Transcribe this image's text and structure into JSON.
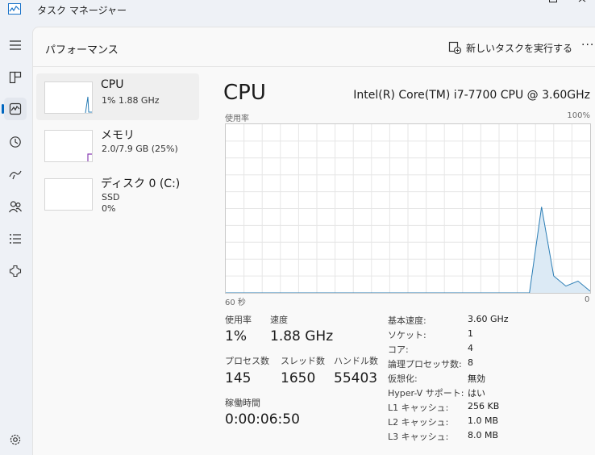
{
  "app": {
    "title": "タスク マネージャー"
  },
  "header": {
    "page_title": "パフォーマンス",
    "new_task_label": "新しいタスクを実行する",
    "more_label": "···"
  },
  "cards": [
    {
      "title": "CPU",
      "line1": "1%  1.88 GHz",
      "accent": "#2a7db5"
    },
    {
      "title": "メモリ",
      "line1": "2.0/7.9 GB (25%)",
      "accent": "#8a3fb3"
    },
    {
      "title": "ディスク 0 (C:)",
      "line1": "SSD",
      "line2": "0%",
      "accent": "#4d9b3b"
    }
  ],
  "detail": {
    "title": "CPU",
    "model": "Intel(R) Core(TM) i7-7700 CPU @ 3.60GHz",
    "graph_label": "使用率",
    "graph_max": "100%",
    "graph_left": "60 秒",
    "graph_right": "0",
    "stats": {
      "usage_label": "使用率",
      "usage_value": "1%",
      "speed_label": "速度",
      "speed_value": "1.88 GHz",
      "proc_label": "プロセス数",
      "proc_value": "145",
      "thread_label": "スレッド数",
      "thread_value": "1650",
      "handle_label": "ハンドル数",
      "handle_value": "55403",
      "uptime_label": "稼働時間",
      "uptime_value": "0:00:06:50"
    },
    "specs": [
      {
        "k": "基本速度:",
        "v": "3.60 GHz"
      },
      {
        "k": "ソケット:",
        "v": "1"
      },
      {
        "k": "コア:",
        "v": "4"
      },
      {
        "k": "論理プロセッサ数:",
        "v": "8"
      },
      {
        "k": "仮想化:",
        "v": "無効"
      },
      {
        "k": "Hyper-V サポート:",
        "v": "はい"
      },
      {
        "k": "L1 キャッシュ:",
        "v": "256 KB"
      },
      {
        "k": "L2 キャッシュ:",
        "v": "1.0 MB"
      },
      {
        "k": "L3 キャッシュ:",
        "v": "8.0 MB"
      }
    ]
  },
  "chart_data": {
    "type": "area",
    "x": [
      60,
      58,
      56,
      54,
      52,
      50,
      48,
      46,
      44,
      42,
      40,
      38,
      36,
      34,
      32,
      30,
      28,
      26,
      24,
      22,
      20,
      18,
      16,
      14,
      12,
      10,
      8,
      6,
      4,
      2,
      0
    ],
    "series": [
      {
        "values": [
          0,
          0,
          0,
          0,
          0,
          0,
          0,
          0,
          0,
          0,
          0,
          0,
          0,
          0,
          0,
          0,
          0,
          0,
          0,
          0,
          0,
          0,
          0,
          0,
          0,
          0,
          51,
          10,
          4,
          7,
          1
        ]
      }
    ],
    "ylim": [
      0,
      100
    ],
    "xlim": [
      60,
      0
    ],
    "grid": true,
    "color": "#2a7db5"
  }
}
